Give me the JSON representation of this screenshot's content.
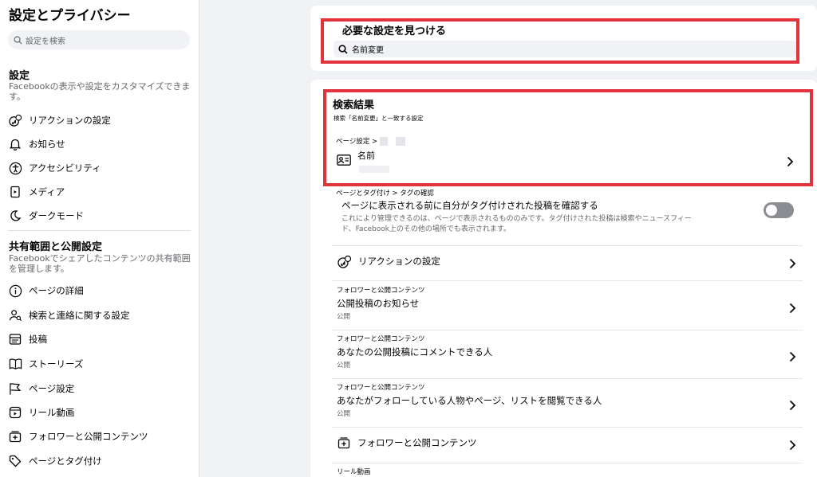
{
  "sidebar": {
    "title": "設定とプライバシー",
    "search_placeholder": "設定を検索",
    "settings_head": "設定",
    "settings_desc": "Facebookの表示や設定をカスタマイズできます。",
    "settings_items": [
      {
        "label": "リアクションの設定",
        "icon": "reaction-icon"
      },
      {
        "label": "お知らせ",
        "icon": "bell-icon"
      },
      {
        "label": "アクセシビリティ",
        "icon": "accessibility-icon"
      },
      {
        "label": "メディア",
        "icon": "media-icon"
      },
      {
        "label": "ダークモード",
        "icon": "moon-icon"
      }
    ],
    "sharing_head": "共有範囲と公開設定",
    "sharing_desc": "Facebookでシェアしたコンテンツの共有範囲を管理します。",
    "sharing_items": [
      {
        "label": "ページの詳細",
        "icon": "info-icon"
      },
      {
        "label": "検索と連絡に関する設定",
        "icon": "person-search-icon"
      },
      {
        "label": "投稿",
        "icon": "post-icon"
      },
      {
        "label": "ストーリーズ",
        "icon": "book-icon"
      },
      {
        "label": "ページ設定",
        "icon": "flag-icon"
      },
      {
        "label": "リール動画",
        "icon": "reels-icon"
      },
      {
        "label": "フォロワーと公開コンテンツ",
        "icon": "followers-icon"
      },
      {
        "label": "ページとタグ付け",
        "icon": "tag-icon"
      }
    ]
  },
  "find": {
    "title": "必要な設定を見つける",
    "query": "名前変更"
  },
  "results": {
    "title": "検索結果",
    "subtitle": "検索「名前変更」と一致する設定",
    "first": {
      "crumb": "ページ設定 >",
      "title": "名前",
      "icon": "id-card-icon"
    },
    "tag_review": {
      "crumb": "ページとタグ付け > タグの確認",
      "title": "ページに表示される前に自分がタグ付けされた投稿を確認する",
      "desc_line1": "これにより管理できるのは、ページで表示されるもののみです。タグ付けされた投稿は検索やニュースフィー",
      "desc_line2": "ド、Facebook上のその他の場所でも表示されます。",
      "enabled": false
    },
    "reaction_row": {
      "title": "リアクションの設定",
      "icon": "reaction-icon"
    },
    "public_notify": {
      "crumb": "フォロワーと公開コンテンツ",
      "title": "公開投稿のお知らせ",
      "sub": "公開"
    },
    "public_comment": {
      "crumb": "フォロワーと公開コンテンツ",
      "title": "あなたの公開投稿にコメントできる人",
      "sub": "公開"
    },
    "following_list": {
      "crumb": "フォロワーと公開コンテンツ",
      "title": "あなたがフォローしている人物やページ、リストを閲覧できる人",
      "sub": "公開"
    },
    "followers_row": {
      "title": "フォロワーと公開コンテンツ",
      "icon": "followers-icon"
    },
    "reels_crumb": "リール動画"
  },
  "colors": {
    "highlight": "#e2333d",
    "toggle_off": "#8a8d91",
    "secondary_text": "#65676b"
  }
}
